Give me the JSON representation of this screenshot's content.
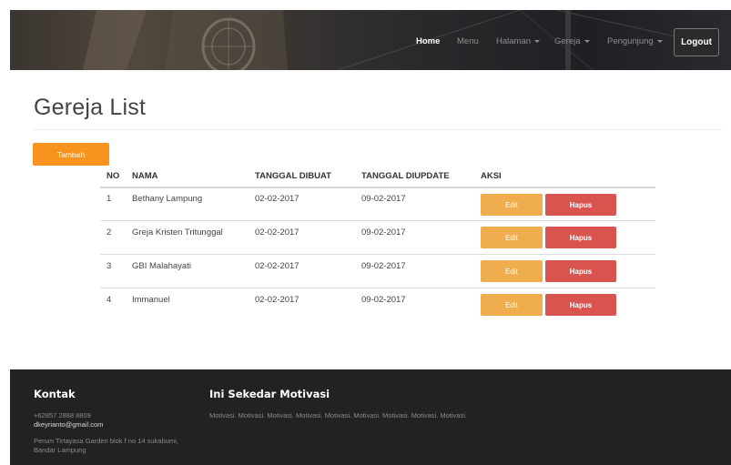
{
  "nav": {
    "home": "Home",
    "menu": "Menu",
    "halaman": "Halaman",
    "gereja": "Gereja",
    "pengunjung": "Pengunjung",
    "logout": "Logout"
  },
  "page": {
    "title": "Gereja List",
    "add_button": "Tambah"
  },
  "table": {
    "headers": [
      "NO",
      "NAMA",
      "TANGGAL DIBUAT",
      "TANGGAL DIUPDATE",
      "AKSI"
    ],
    "rows": [
      {
        "no": "1",
        "nama": "Bethany Lampung",
        "dibuat": "02-02-2017",
        "diupdate": "09-02-2017"
      },
      {
        "no": "2",
        "nama": "Greja Kristen Tritunggal",
        "dibuat": "02-02-2017",
        "diupdate": "09-02-2017"
      },
      {
        "no": "3",
        "nama": "GBI Malahayati",
        "dibuat": "02-02-2017",
        "diupdate": "09-02-2017"
      },
      {
        "no": "4",
        "nama": "Immanuel",
        "dibuat": "02-02-2017",
        "diupdate": "09-02-2017"
      }
    ],
    "edit_label": "Edit",
    "hapus_label": "Hapus"
  },
  "footer": {
    "kontak_title": "Kontak",
    "phone": "+62857 2888 8809",
    "email": "dkeyrianto@gmail.com",
    "address_line1": "Perum Tirtayasa Garden blok f no 14 sukabumi,",
    "address_line2": "Bandar Lampung",
    "motivasi_title": "Ini Sekedar Motivasi",
    "motivasi_text": "Motivasi. Motivasi. Motivasi. Motivasi. Motivasi. Motivasi. Motivasi. Motivasi. Motivasi."
  },
  "colors": {
    "accent": "#f7931e",
    "edit": "#f0ad4e",
    "hapus": "#d9534f",
    "footer_bg": "#222222"
  }
}
